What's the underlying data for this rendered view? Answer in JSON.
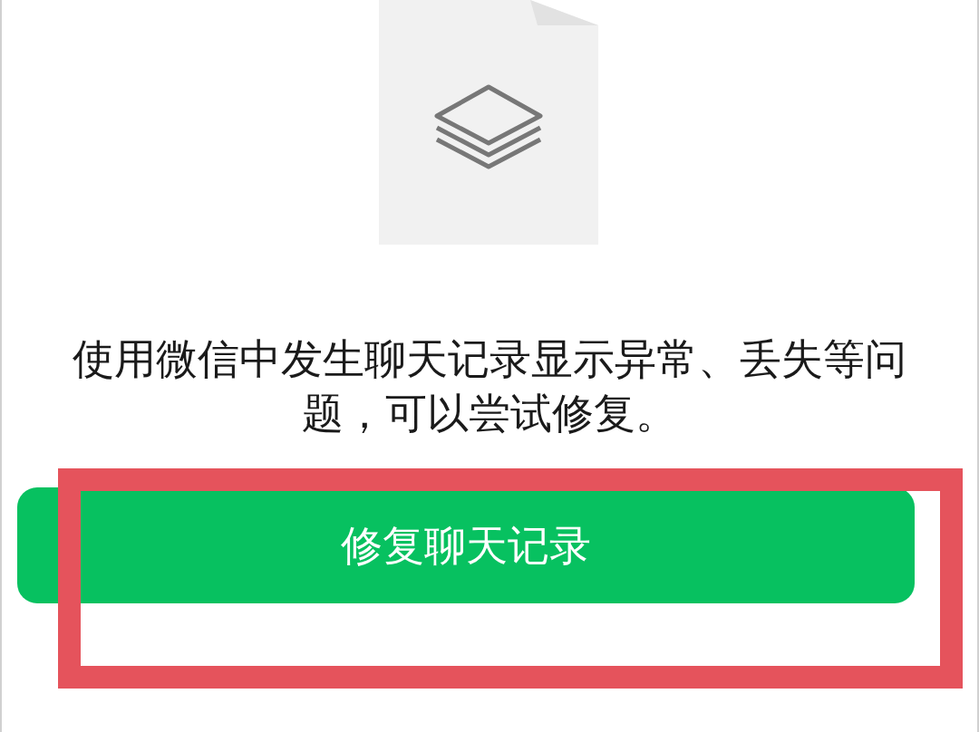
{
  "description": "使用微信中发生聊天记录显示异常、丢失等问题，可以尝试修复。",
  "repair_button": {
    "label": "修复聊天记录"
  }
}
